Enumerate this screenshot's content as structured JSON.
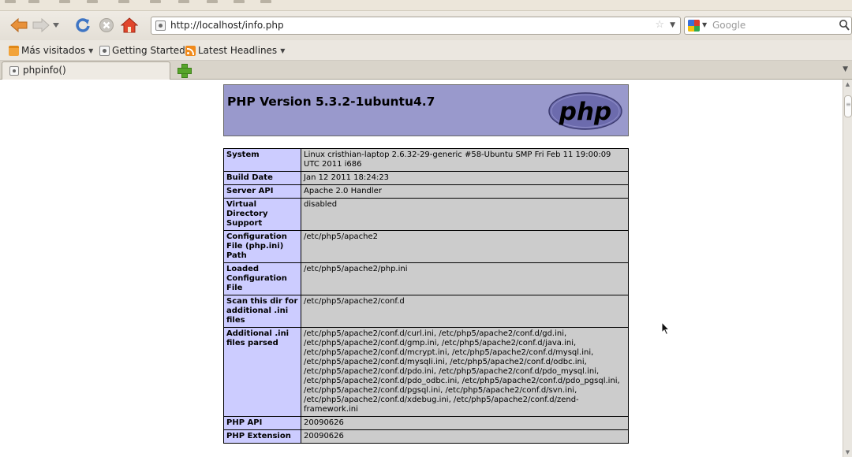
{
  "browser": {
    "url": "http://localhost/info.php",
    "search_placeholder": "Google",
    "bookmarks": [
      {
        "label": "Más visitados",
        "icon": "folder-icon",
        "has_menu": true
      },
      {
        "label": "Getting Started",
        "icon": "page-icon",
        "has_menu": false
      },
      {
        "label": "Latest Headlines",
        "icon": "rss-icon",
        "has_menu": true
      }
    ],
    "tab": {
      "title": "phpinfo()"
    }
  },
  "page": {
    "header_title": "PHP Version 5.3.2-1ubuntu4.7",
    "logo_text": "php",
    "rows": [
      {
        "key": "System",
        "value": "Linux cristhian-laptop 2.6.32-29-generic #58-Ubuntu SMP Fri Feb 11 19:00:09 UTC 2011 i686"
      },
      {
        "key": "Build Date",
        "value": "Jan 12 2011 18:24:23"
      },
      {
        "key": "Server API",
        "value": "Apache 2.0 Handler"
      },
      {
        "key": "Virtual Directory Support",
        "value": "disabled"
      },
      {
        "key": "Configuration File (php.ini) Path",
        "value": "/etc/php5/apache2"
      },
      {
        "key": "Loaded Configuration File",
        "value": "/etc/php5/apache2/php.ini"
      },
      {
        "key": "Scan this dir for additional .ini files",
        "value": "/etc/php5/apache2/conf.d"
      },
      {
        "key": "Additional .ini files parsed",
        "value": "/etc/php5/apache2/conf.d/curl.ini, /etc/php5/apache2/conf.d/gd.ini, /etc/php5/apache2/conf.d/gmp.ini, /etc/php5/apache2/conf.d/java.ini, /etc/php5/apache2/conf.d/mcrypt.ini, /etc/php5/apache2/conf.d/mysql.ini, /etc/php5/apache2/conf.d/mysqli.ini, /etc/php5/apache2/conf.d/odbc.ini, /etc/php5/apache2/conf.d/pdo.ini, /etc/php5/apache2/conf.d/pdo_mysql.ini, /etc/php5/apache2/conf.d/pdo_odbc.ini, /etc/php5/apache2/conf.d/pdo_pgsql.ini, /etc/php5/apache2/conf.d/pgsql.ini, /etc/php5/apache2/conf.d/svn.ini, /etc/php5/apache2/conf.d/xdebug.ini, /etc/php5/apache2/conf.d/zend-framework.ini"
      },
      {
        "key": "PHP API",
        "value": "20090626"
      },
      {
        "key": "PHP Extension",
        "value": "20090626"
      }
    ]
  },
  "colors": {
    "header_bg": "#9999cc",
    "key_bg": "#ccccff",
    "value_bg": "#cccccc"
  }
}
